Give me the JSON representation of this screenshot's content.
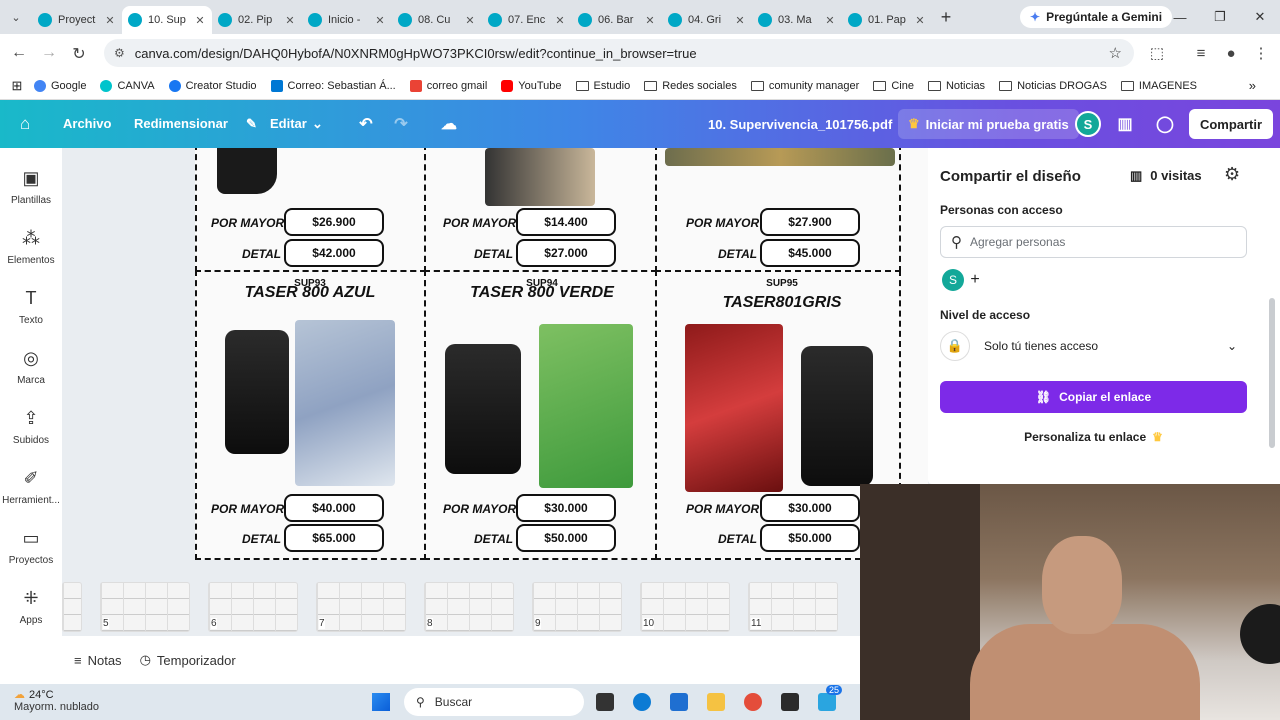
{
  "browser": {
    "tabs": [
      {
        "label": "Proyect",
        "active": false
      },
      {
        "label": "10. Sup",
        "active": true
      },
      {
        "label": "02. Pip",
        "active": false
      },
      {
        "label": "Inicio -",
        "active": false
      },
      {
        "label": "08. Cu",
        "active": false
      },
      {
        "label": "07. Enc",
        "active": false
      },
      {
        "label": "06. Bar",
        "active": false
      },
      {
        "label": "04. Gri",
        "active": false
      },
      {
        "label": "03. Ma",
        "active": false
      },
      {
        "label": "01. Pap",
        "active": false
      }
    ],
    "gemini_label": "Pregúntale a Gemini",
    "url": "canva.com/design/DAHQ0HybofA/N0XNRM0gHpWO73PKCI0rsw/edit?continue_in_browser=true",
    "bookmarks": [
      {
        "label": "Google",
        "color": "#4285f4"
      },
      {
        "label": "CANVA",
        "color": "#00c4cc"
      },
      {
        "label": "Creator Studio",
        "color": "#1877f2"
      },
      {
        "label": "Correo: Sebastian Á...",
        "color": "#0078d4"
      },
      {
        "label": "correo gmail",
        "color": "#ea4335"
      },
      {
        "label": "YouTube",
        "color": "#ff0000"
      },
      {
        "label": "Estudio",
        "folder": true
      },
      {
        "label": "Redes sociales",
        "folder": true
      },
      {
        "label": "comunity manager",
        "folder": true
      },
      {
        "label": "Cine",
        "folder": true
      },
      {
        "label": "Noticias",
        "folder": true
      },
      {
        "label": "Noticias DROGAS",
        "folder": true
      },
      {
        "label": "IMAGENES",
        "folder": true
      }
    ]
  },
  "canva": {
    "menu": {
      "file": "Archivo",
      "resize": "Redimensionar",
      "edit": "Editar"
    },
    "filename": "10. Supervivencia_101756.pdf",
    "trial": "Iniciar mi prueba gratis",
    "avatar_letter": "S",
    "share": "Compartir",
    "sidebar": [
      {
        "label": "Plantillas",
        "icon": "template-icon"
      },
      {
        "label": "Elementos",
        "icon": "elements-icon"
      },
      {
        "label": "Texto",
        "icon": "text-icon"
      },
      {
        "label": "Marca",
        "icon": "brand-icon"
      },
      {
        "label": "Subidos",
        "icon": "upload-icon"
      },
      {
        "label": "Herramient...",
        "icon": "tools-icon"
      },
      {
        "label": "Proyectos",
        "icon": "folder-icon"
      },
      {
        "label": "Apps",
        "icon": "apps-icon"
      }
    ],
    "catalog": {
      "top_row": [
        {
          "wholesale": "$26.900",
          "retail": "$42.000"
        },
        {
          "wholesale": "$14.400",
          "retail": "$27.000"
        },
        {
          "wholesale": "$27.900",
          "retail": "$45.000"
        }
      ],
      "labels": {
        "wholesale": "POR MAYOR",
        "retail": "DETAL"
      },
      "bottom_row": [
        {
          "code": "SUP93",
          "title": "TASER 800 AZUL",
          "wholesale": "$40.000",
          "retail": "$65.000"
        },
        {
          "code": "SUP94",
          "title": "TASER 800 VERDE",
          "wholesale": "$30.000",
          "retail": "$50.000"
        },
        {
          "code": "SUP95",
          "title": "TASER801GRIS",
          "wholesale": "$30.000",
          "retail": "$50.000"
        }
      ]
    },
    "pages": [
      "5",
      "6",
      "7",
      "8",
      "9",
      "10",
      "11"
    ],
    "bottom": {
      "notes": "Notas",
      "timer": "Temporizador"
    },
    "share_panel": {
      "title": "Compartir el diseño",
      "visits": "0 visitas",
      "people_label": "Personas con acceso",
      "add_placeholder": "Agregar personas",
      "access_label": "Nivel de acceso",
      "access_value": "Solo tú tienes acceso",
      "copy_link": "Copiar el enlace",
      "customize": "Personaliza tu enlace"
    }
  },
  "taskbar": {
    "temp": "24°C",
    "weather": "Mayorm. nublado",
    "search": "Buscar",
    "badge": "25"
  }
}
